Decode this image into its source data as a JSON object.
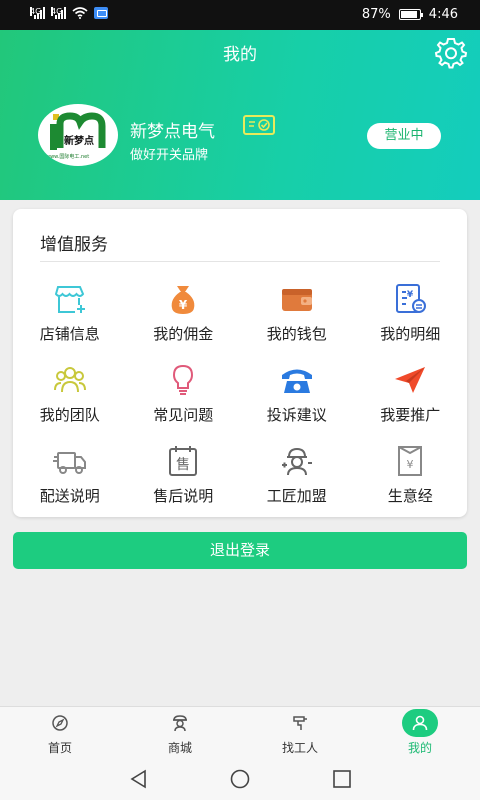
{
  "status_bar": {
    "signal_label_1": "4G",
    "signal_label_2": "4G",
    "battery_percent": "87%",
    "time": "4:46"
  },
  "header": {
    "title": "我的",
    "shop_name": "新梦点电气",
    "shop_slogan": "做好开关品牌",
    "status_badge": "营业中",
    "logo_text": "新梦点",
    "logo_url": "www.国际电工.net"
  },
  "services": {
    "title": "增值服务",
    "items": [
      {
        "label": "店铺信息",
        "icon": "shop-icon",
        "color": "#3ec7d6"
      },
      {
        "label": "我的佣金",
        "icon": "money-bag-icon",
        "color": "#f08a3c"
      },
      {
        "label": "我的钱包",
        "icon": "wallet-icon",
        "color": "#e07a3c"
      },
      {
        "label": "我的明细",
        "icon": "bill-detail-icon",
        "color": "#3a6fd8"
      },
      {
        "label": "我的团队",
        "icon": "team-icon",
        "color": "#c8c83c"
      },
      {
        "label": "常见问题",
        "icon": "lightbulb-icon",
        "color": "#e05a7a"
      },
      {
        "label": "投诉建议",
        "icon": "telephone-icon",
        "color": "#2a7ae0"
      },
      {
        "label": "我要推广",
        "icon": "paper-plane-icon",
        "color": "#f04a2a"
      },
      {
        "label": "配送说明",
        "icon": "delivery-truck-icon",
        "color": "#888888"
      },
      {
        "label": "售后说明",
        "icon": "after-sale-icon",
        "color": "#666666"
      },
      {
        "label": "工匠加盟",
        "icon": "worker-icon",
        "color": "#666666"
      },
      {
        "label": "生意经",
        "icon": "business-book-icon",
        "color": "#888888"
      }
    ]
  },
  "logout_label": "退出登录",
  "tabs": [
    {
      "label": "首页",
      "icon": "compass-icon"
    },
    {
      "label": "商城",
      "icon": "mall-icon"
    },
    {
      "label": "找工人",
      "icon": "find-worker-icon"
    },
    {
      "label": "我的",
      "icon": "profile-icon",
      "active": true
    }
  ],
  "colors": {
    "accent": "#1dcc80",
    "header_start": "#22c77a",
    "header_end": "#14cdbd"
  }
}
